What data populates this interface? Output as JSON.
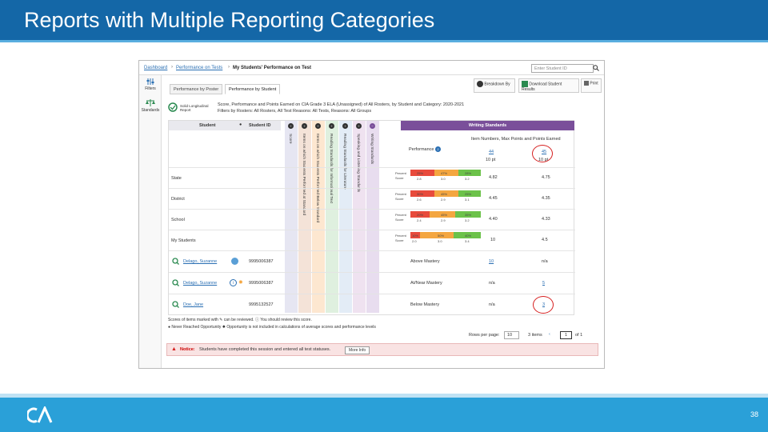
{
  "slide": {
    "title": "Reports with Multiple Reporting Categories",
    "page_number": "38",
    "logo_text": "CA"
  },
  "report": {
    "breadcrumbs": [
      "Dashboard",
      "Performance on Tests",
      "My Students' Performance on Test"
    ],
    "student_search_placeholder": "Enter Student ID",
    "rail": [
      {
        "icon": "filter-icon",
        "label": "Filters"
      },
      {
        "icon": "scales-icon",
        "label": "Standards"
      }
    ],
    "tabs": [
      "Performance by Poster",
      "Performance by Student"
    ],
    "toolbar": [
      "Breakdown By",
      "Download Student Results",
      "Print"
    ],
    "badge_text": "Solid Longitudinal Report",
    "info_line1": "Score, Performance and Points Earned on CIA Grade 3 ELA (Unassigned) of All Rosters, by Student and Category: 2020-2021",
    "info_line2": "Filters by Rosters: All Rosters, All Test Reasons: All Tests, Reasons: All Groups",
    "columns": {
      "student": "Student",
      "student_id": "Student ID"
    },
    "writing_standards": "Writing Standards",
    "performance_label": "Performance",
    "item_numbers_label": "Item Numbers, Max Points and Points Earned",
    "item_cols": [
      {
        "num": "44",
        "pts": "10 pt"
      },
      {
        "num": "45",
        "pts": "10 pt"
      }
    ],
    "vertical_labels": [
      "Score",
      "Items on which Students Performed at Standard",
      "Items on which Students Performed Below Standard",
      "Reading Standards for Informational Text",
      "Reading Standards for Literature",
      "Speaking and Listening Standards",
      "Writing Standards"
    ],
    "rows": [
      {
        "name": "State",
        "pct": [
          "25%",
          "47%",
          "28%"
        ],
        "scores": [
          "2.8",
          "3.0",
          "3.2"
        ],
        "v1": "4.82",
        "v2": "4.75"
      },
      {
        "name": "District",
        "pct": [
          "30%",
          "45%",
          "25%"
        ],
        "scores": [
          "2.6",
          "2.9",
          "3.1"
        ],
        "v1": "4.45",
        "v2": "4.35"
      },
      {
        "name": "School",
        "pct": [
          "20%",
          "45%",
          "35%"
        ],
        "scores": [
          "2.4",
          "2.9",
          "3.2"
        ],
        "v1": "4.40",
        "v2": "4.33"
      },
      {
        "name": "My Students",
        "pct": [
          "10%",
          "50%",
          "40%"
        ],
        "scores": [
          "2.0",
          "3.0",
          "3.4"
        ],
        "v1": "10",
        "v2": "4.5"
      }
    ],
    "percent_label": "Percent",
    "score_label": "Score",
    "students": [
      {
        "name": "Delago, Suzanne",
        "id": "9995006387",
        "perf": "Above Mastery",
        "v1": "10",
        "v2": "n/a"
      },
      {
        "name": "Delago, Suzanne",
        "id": "9995006387",
        "perf": "At/Near Mastery",
        "v1": "n/a",
        "v2": "5"
      },
      {
        "name": "Doe, Jane",
        "id": "9995132527",
        "perf": "Below Mastery",
        "v1": "n/a",
        "v2": "3"
      }
    ],
    "legend1": "Scores of items marked with ✎ can be reviewed.  ⓘ You should review this score.",
    "legend2": "● Never Reached Opportunity  ✹ Opportunity is not included in calculations of average scores and performance levels",
    "pager": {
      "rows_label": "Rows per page:",
      "rows_value": "10",
      "items": "3 items",
      "page": "1",
      "of": "of 1"
    },
    "notice_label": "Notice:",
    "notice_text": "Students have completed this session and entered all test statuses.",
    "more_info": "More Info",
    "colors": {
      "title_bar": "#1467a7",
      "footer": "#2aa0d8",
      "purple": "#7a4f9a",
      "red": "#e84b3c",
      "orange": "#f4a640",
      "green": "#6cc24a"
    }
  }
}
